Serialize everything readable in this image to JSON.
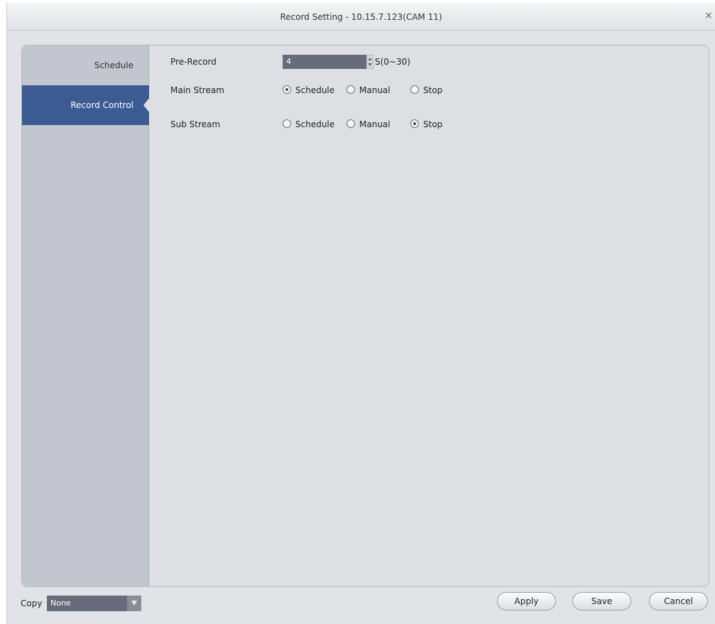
{
  "window": {
    "title": "Record Setting - 10.15.7.123(CAM 11)",
    "close_icon": "×"
  },
  "sidebar": {
    "items": [
      {
        "label": "Schedule",
        "selected": false
      },
      {
        "label": "Record Control",
        "selected": true
      }
    ]
  },
  "form": {
    "pre_record": {
      "label": "Pre-Record",
      "value": "4",
      "unit": "S(0~30)"
    },
    "main_stream": {
      "label": "Main Stream",
      "options": [
        "Schedule",
        "Manual",
        "Stop"
      ],
      "selected": "Schedule"
    },
    "sub_stream": {
      "label": "Sub Stream",
      "options": [
        "Schedule",
        "Manual",
        "Stop"
      ],
      "selected": "Stop"
    }
  },
  "footer": {
    "copy_label": "Copy",
    "copy_value": "None",
    "apply_label": "Apply",
    "save_label": "Save",
    "cancel_label": "Cancel"
  },
  "colors": {
    "sidebar_selected": "#3c5b93",
    "input_bg": "#696b7a",
    "dialog_bg": "#e1e3e7"
  }
}
